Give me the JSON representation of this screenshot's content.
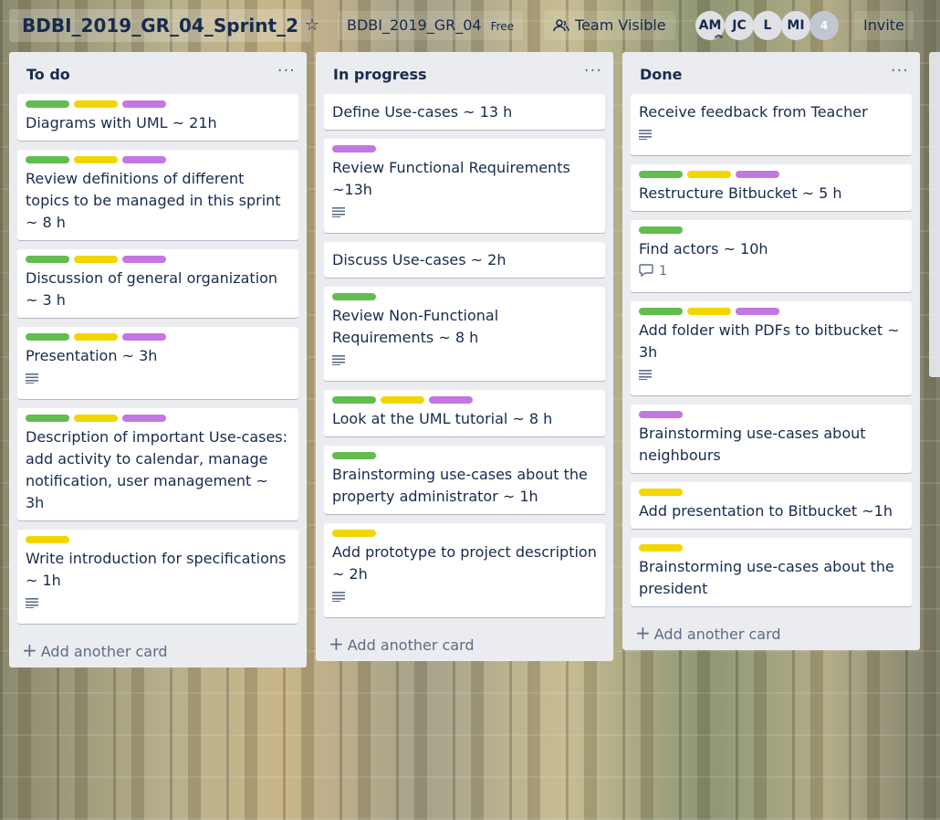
{
  "board": {
    "title": "BDBI_2019_GR_04_Sprint_2",
    "team": "BDBI_2019_GR_04",
    "plan": "Free",
    "visibility": "Team Visible",
    "members": [
      "AM",
      "JC",
      "L",
      "MI"
    ],
    "more_members": "4",
    "invite": "Invite"
  },
  "add_card_label": "Add another card",
  "lists": [
    {
      "title": "To do",
      "cards": [
        {
          "title": "Diagrams with UML ~ 21h"
        },
        {
          "title": "Review definitions of different topics to be managed in this sprint ~ 8 h"
        },
        {
          "title": "Discussion of general organization ~ 3 h"
        },
        {
          "title": "Presentation ~ 3h"
        },
        {
          "title": "Description of important Use-cases: add activity to calendar, manage notification, user management ~ 3h"
        },
        {
          "title": "Write introduction for specifications ~ 1h"
        }
      ]
    },
    {
      "title": "In progress",
      "cards": [
        {
          "title": "Define Use-cases ~ 13 h"
        },
        {
          "title": "Review Functional Requirements ~13h"
        },
        {
          "title": "Discuss Use-cases ~ 2h"
        },
        {
          "title": "Review Non-Functional Requirements ~ 8 h"
        },
        {
          "title": "Look at the UML tutorial ~ 8 h"
        },
        {
          "title": "Brainstorming use-cases about the property administrator ~ 1h"
        },
        {
          "title": "Add prototype to project description ~ 2h"
        }
      ]
    },
    {
      "title": "Done",
      "cards": [
        {
          "title": "Receive feedback from Teacher"
        },
        {
          "title": "Restructure Bitbucket ~ 5 h"
        },
        {
          "title": "Find actors ~ 10h",
          "comments": "1"
        },
        {
          "title": "Add folder with PDFs to bitbucket ~ 3h"
        },
        {
          "title": "Brainstorming use-cases about neighbours"
        },
        {
          "title": "Add presentation to Bitbucket ~1h"
        },
        {
          "title": "Brainstorming use-cases about the president"
        }
      ]
    }
  ],
  "label_colors": {
    "green": "#61bd4f",
    "yellow": "#f2d600",
    "purple": "#c377e0"
  }
}
